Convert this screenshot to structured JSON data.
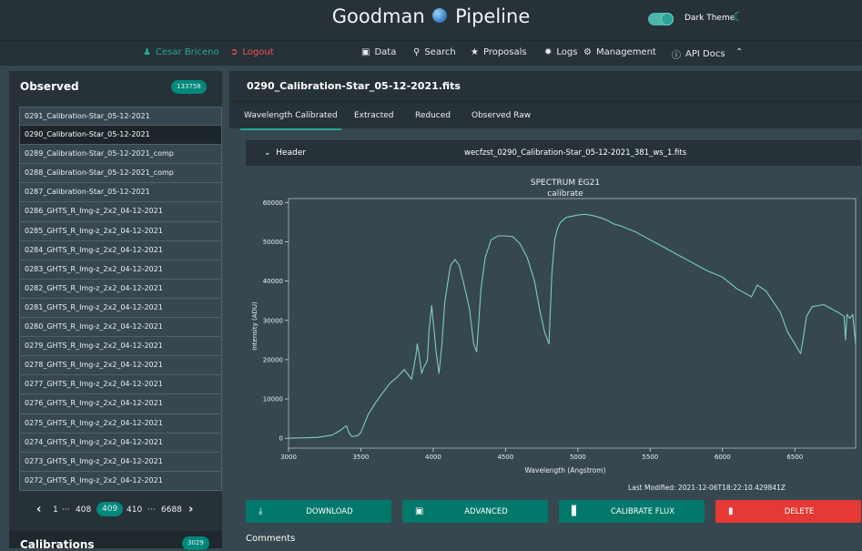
{
  "app": {
    "title_left": "Goodman",
    "title_right": "Pipeline",
    "theme_label": "Dark Theme"
  },
  "nav": {
    "user": "Cesar Briceno",
    "logout": "Logout",
    "items": [
      "Data",
      "Search",
      "Proposals",
      "Logs",
      "Management",
      "API Docs"
    ]
  },
  "sidebar": {
    "title": "Observed",
    "count": "133758",
    "items": [
      "0291_Calibration-Star_05-12-2021",
      "0290_Calibration-Star_05-12-2021",
      "0289_Calibration-Star_05-12-2021_comp",
      "0288_Calibration-Star_05-12-2021_comp",
      "0287_Calibration-Star_05-12-2021",
      "0286_GHTS_R_Img-z_2x2_04-12-2021",
      "0285_GHTS_R_Img-z_2x2_04-12-2021",
      "0284_GHTS_R_Img-z_2x2_04-12-2021",
      "0283_GHTS_R_Img-z_2x2_04-12-2021",
      "0282_GHTS_R_Img-z_2x2_04-12-2021",
      "0281_GHTS_R_Img-z_2x2_04-12-2021",
      "0280_GHTS_R_Img-z_2x2_04-12-2021",
      "0279_GHTS_R_Img-z_2x2_04-12-2021",
      "0278_GHTS_R_Img-z_2x2_04-12-2021",
      "0277_GHTS_R_Img-z_2x2_04-12-2021",
      "0276_GHTS_R_Img-z_2x2_04-12-2021",
      "0275_GHTS_R_Img-z_2x2_04-12-2021",
      "0274_GHTS_R_Img-z_2x2_04-12-2021",
      "0273_GHTS_R_Img-z_2x2_04-12-2021",
      "0272_GHTS_R_Img-z_2x2_04-12-2021"
    ],
    "pager": {
      "first": "1",
      "ellipsis": "···",
      "prev": "408",
      "current": "409",
      "next": "410",
      "last": "6688"
    },
    "calibrations_title": "Calibrations",
    "calibrations_count": "3029"
  },
  "main": {
    "file_title": "0290_Calibration-Star_05-12-2021.fits",
    "tabs": [
      "Wavelength Calibrated",
      "Extracted",
      "Reduced",
      "Observed Raw"
    ],
    "header_toggle": "Header",
    "header_file": "wecfzst_0290_Calibration-Star_05-12-2021_381_ws_1.fits",
    "last_modified": "Last Modified: 2021-12-06T18:22:10.429841Z",
    "buttons": {
      "download": "DOWNLOAD",
      "advanced": "ADVANCED",
      "calibrate": "CALIBRATE FLUX",
      "delete": "DELETE"
    },
    "comments": "Comments"
  },
  "colors": {
    "accent": "#26a69a",
    "line": "#80cbc4",
    "danger": "#e53935"
  },
  "chart_data": {
    "type": "line",
    "title": "SPECTRUM EG21",
    "subtitle": "calibrate",
    "xlabel": "Wavelength (Angstrom)",
    "ylabel": "Intensity (ADU)",
    "xlim": [
      3000,
      6920
    ],
    "ylim": [
      -2500,
      61000
    ],
    "xticks": [
      3000,
      3500,
      4000,
      4500,
      5000,
      5500,
      6000,
      6500
    ],
    "yticks": [
      0,
      10000,
      20000,
      30000,
      40000,
      50000,
      60000
    ],
    "series": [
      {
        "x": [
          3000,
          3200,
          3300,
          3350,
          3400,
          3420,
          3440,
          3480,
          3500,
          3550,
          3600,
          3650,
          3700,
          3750,
          3800,
          3850,
          3880,
          3890,
          3900,
          3920,
          3940,
          3950,
          3960,
          3970,
          3990,
          4020,
          4040,
          4060,
          4080,
          4100,
          4120,
          4150,
          4180,
          4220,
          4250,
          4280,
          4300,
          4310,
          4330,
          4360,
          4400,
          4450,
          4500,
          4550,
          4600,
          4650,
          4700,
          4740,
          4770,
          4800,
          4820,
          4840,
          4860,
          4880,
          4920,
          4960,
          5000,
          5050,
          5100,
          5150,
          5200,
          5250,
          5300,
          5400,
          5500,
          5600,
          5700,
          5800,
          5900,
          6000,
          6100,
          6200,
          6240,
          6300,
          6400,
          6450,
          6500,
          6540,
          6560,
          6580,
          6620,
          6700,
          6800,
          6840,
          6850,
          6860,
          6880,
          6900,
          6920
        ],
        "y": [
          0,
          200,
          800,
          1800,
          3200,
          1200,
          400,
          700,
          1500,
          6000,
          9000,
          11500,
          14000,
          15500,
          17500,
          15000,
          21000,
          24000,
          22000,
          16500,
          18500,
          19000,
          20000,
          27000,
          33800,
          22000,
          16500,
          24000,
          34500,
          39500,
          44000,
          45500,
          44000,
          38000,
          33000,
          24000,
          22000,
          27000,
          38000,
          46000,
          50500,
          51500,
          51500,
          51300,
          49500,
          46000,
          40000,
          32000,
          27000,
          24000,
          42000,
          50500,
          53500,
          55000,
          56200,
          56500,
          56800,
          57000,
          56700,
          56200,
          55500,
          54500,
          54000,
          52500,
          50500,
          48500,
          46500,
          44500,
          42500,
          41000,
          38000,
          36000,
          39000,
          37500,
          32000,
          27000,
          24000,
          21500,
          26000,
          31000,
          33500,
          34000,
          32000,
          31000,
          25000,
          31500,
          30500,
          31500,
          24000
        ]
      }
    ]
  }
}
